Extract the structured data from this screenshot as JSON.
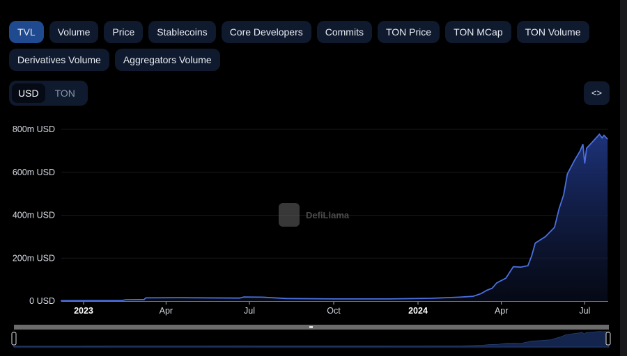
{
  "tabs": [
    "TVL",
    "Volume",
    "Price",
    "Stablecoins",
    "Core Developers",
    "Commits",
    "TON Price",
    "TON MCap",
    "TON Volume",
    "Derivatives Volume",
    "Aggregators Volume"
  ],
  "active_tab": "TVL",
  "currency_toggle": {
    "options": [
      "USD",
      "TON"
    ],
    "selected": "USD"
  },
  "embed_button": {
    "label": "<>",
    "icon": "code-icon"
  },
  "watermark": "DefiLlama",
  "colors": {
    "line": "#4a6fe0",
    "area_top": "#1f3580",
    "accent": "#1f4a8f"
  },
  "chart_data": {
    "type": "area",
    "title": "",
    "xlabel": "",
    "ylabel": "",
    "ylim": [
      0,
      800
    ],
    "y_unit": "m USD",
    "y_ticks": [
      "0 USD",
      "200m USD",
      "400m USD",
      "600m USD",
      "800m USD"
    ],
    "x_ticks": [
      {
        "date": "2023-01-01",
        "label": "2023",
        "bold": true
      },
      {
        "date": "2023-04-01",
        "label": "Apr"
      },
      {
        "date": "2023-07-01",
        "label": "Jul"
      },
      {
        "date": "2023-10-01",
        "label": "Oct"
      },
      {
        "date": "2024-01-01",
        "label": "2024",
        "bold": true
      },
      {
        "date": "2024-04-01",
        "label": "Apr"
      },
      {
        "date": "2024-07-01",
        "label": "Jul"
      }
    ],
    "grid": true,
    "series": [
      {
        "x": [
          "2022-12-07",
          "2023-02-12",
          "2023-02-16",
          "2023-03-08",
          "2023-03-10",
          "2023-04-15",
          "2023-06-20",
          "2023-06-25",
          "2023-07-15",
          "2023-08-10",
          "2023-10-01",
          "2023-12-01",
          "2024-01-15",
          "2024-02-15",
          "2024-03-01",
          "2024-03-10",
          "2024-03-16",
          "2024-03-22",
          "2024-03-27",
          "2024-04-06",
          "2024-04-14",
          "2024-04-22",
          "2024-04-30",
          "2024-05-04",
          "2024-05-08",
          "2024-05-19",
          "2024-05-29",
          "2024-06-03",
          "2024-06-08",
          "2024-06-12",
          "2024-06-20",
          "2024-06-26",
          "2024-06-29",
          "2024-07-01",
          "2024-07-03",
          "2024-07-10",
          "2024-07-17",
          "2024-07-20",
          "2024-07-22",
          "2024-07-26"
        ],
        "values": [
          2,
          3,
          6,
          7,
          15,
          16,
          14,
          19,
          18,
          12,
          10,
          10,
          13,
          18,
          22,
          35,
          50,
          60,
          85,
          107,
          160,
          158,
          165,
          210,
          270,
          300,
          343,
          430,
          495,
          592,
          657,
          700,
          731,
          641,
          712,
          744,
          777,
          760,
          772,
          754
        ]
      }
    ]
  }
}
